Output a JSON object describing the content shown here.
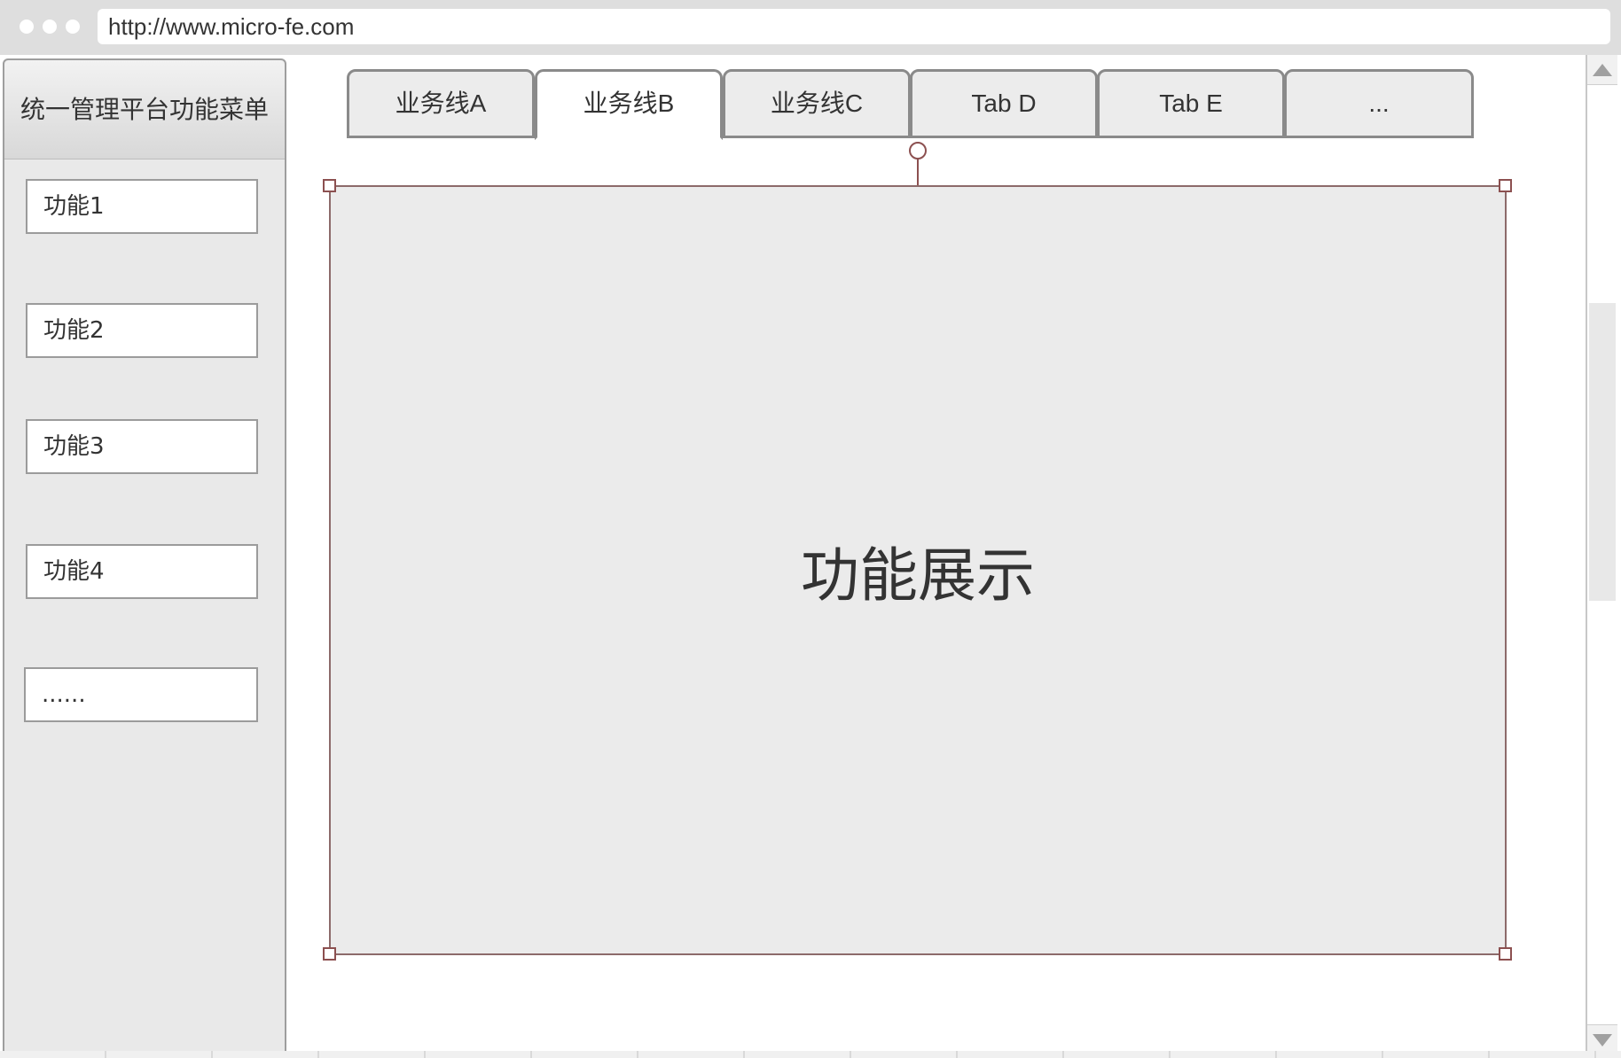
{
  "browser": {
    "url": "http://www.micro-fe.com"
  },
  "sidebar": {
    "title": "统一管理平台功能菜单",
    "items": [
      {
        "label": "功能1"
      },
      {
        "label": "功能2"
      },
      {
        "label": "功能3"
      },
      {
        "label": "功能4"
      },
      {
        "label": "......"
      }
    ]
  },
  "tabs": [
    {
      "label": "业务线A",
      "active": false
    },
    {
      "label": "业务线B",
      "active": true
    },
    {
      "label": "业务线C",
      "active": false
    },
    {
      "label": "Tab D",
      "active": false
    },
    {
      "label": "Tab E",
      "active": false
    },
    {
      "label": "...",
      "active": false
    }
  ],
  "main": {
    "title": "功能展示"
  },
  "colors": {
    "selection_border": "#8c5050",
    "content_bg": "#ebebeb",
    "sidebar_bg": "#e9e9e9"
  }
}
